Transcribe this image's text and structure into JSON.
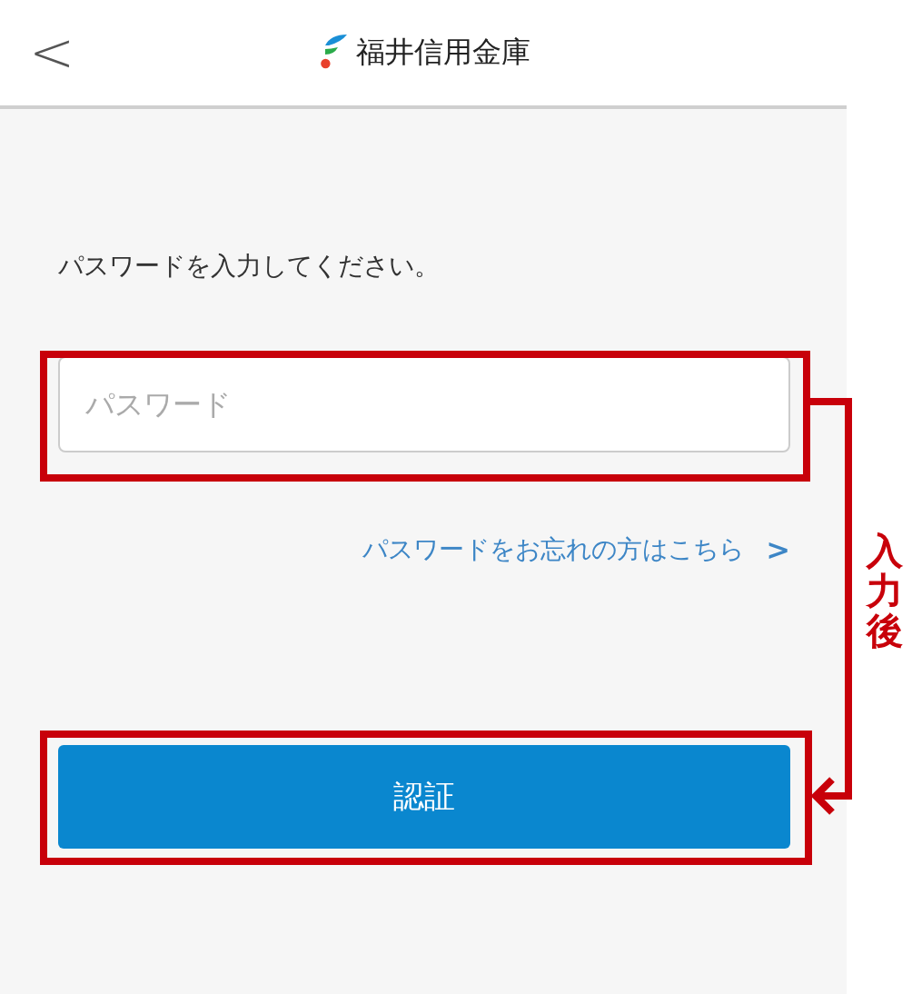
{
  "header": {
    "back": "<",
    "title": "福井信用金庫"
  },
  "instruction": "パスワードを入力してください。",
  "password_field": {
    "placeholder": "パスワード"
  },
  "forgot_link": {
    "label": "パスワードをお忘れの方はこちら",
    "chevron": ">"
  },
  "submit_button": {
    "label": "認証"
  },
  "annotation": {
    "label": "入力後"
  }
}
